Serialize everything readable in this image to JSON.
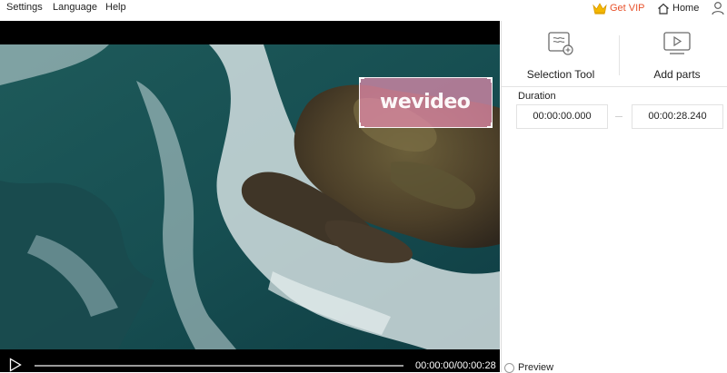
{
  "menu": {
    "settings": "Settings",
    "language": "Language",
    "help": "Help"
  },
  "header": {
    "vip_label": "Get VIP",
    "home_label": "Home"
  },
  "player": {
    "watermark_text": "wevideo",
    "timecode": "00:00:00/00:00:28",
    "progress": 0
  },
  "panel": {
    "selection_tool_label": "Selection Tool",
    "add_parts_label": "Add parts",
    "duration_label": "Duration",
    "start_time": "00:00:00.000",
    "end_time": "00:00:28.240",
    "preview_label": "Preview"
  },
  "colors": {
    "vip": "#e8522c",
    "crown": "#f5b800"
  }
}
